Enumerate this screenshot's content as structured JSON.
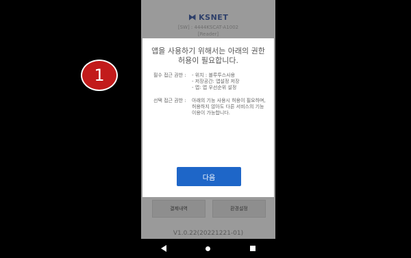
{
  "brand": {
    "logo_text": "KSNET",
    "sw_version": "[SW] : 4444KSCAT-A1002",
    "subtitle": "[Reader]"
  },
  "background_buttons": {
    "left_label": "결제내역",
    "right_label": "환경설정"
  },
  "version_text": "V1.0.22(20221221-01)",
  "dialog": {
    "title": "앱을 사용하기 위해서는 아래의 권한 허용이 필요합니다.",
    "required": {
      "heading": "필수 접근 권한 :",
      "items": [
        "- 위치 : 블루투스사용",
        "- 저장공간: 앱설정 저장",
        "- 앱: 앱 우선순위 설정"
      ]
    },
    "optional": {
      "heading": "선택 접근 권한 :",
      "description": "아래의 기능 사용시 허용이 필요하며, 허용하지 않아도 다른 서비스의 기능 이용이 가능합니다."
    },
    "next_label": "다음"
  },
  "annotation": {
    "number": "1",
    "color": "#c21b1b"
  },
  "colors": {
    "accent": "#1e66c8",
    "overlay_bg": "#9a9a9a"
  }
}
